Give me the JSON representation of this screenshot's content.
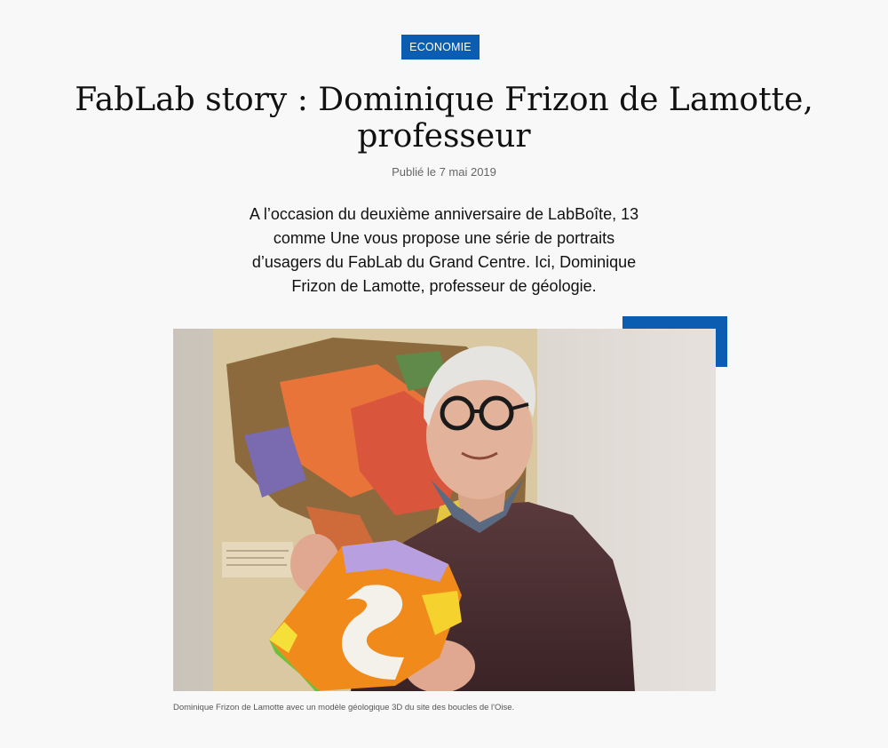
{
  "article": {
    "category": "ECONOMIE",
    "title": "FabLab story : Dominique Frizon de Lamotte, professeur",
    "date": "Publié le 7 mai 2019",
    "lead": "A l’occasion du deuxième anniversaire de LabBoîte, 13 comme Une vous propose une série de portraits d’usagers du FabLab du Grand Centre. Ici, Dominique Frizon de Lamotte, professeur de géologie.",
    "image_caption": "Dominique Frizon de Lamotte avec un modèle géologique 3D du site des boucles de l'Oise."
  },
  "colors": {
    "accent": "#0a5db0",
    "background": "#f8f8f8"
  }
}
